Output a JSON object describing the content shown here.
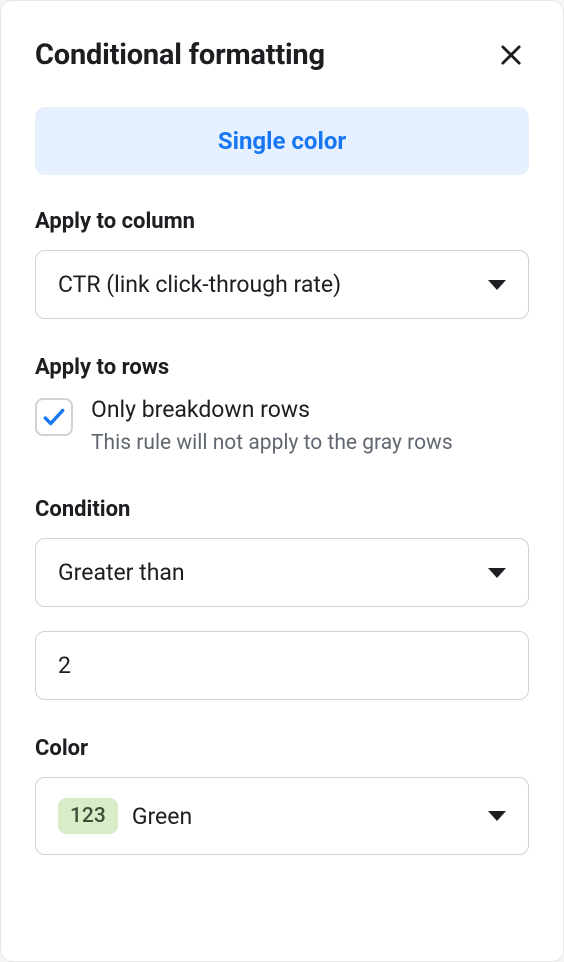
{
  "header": {
    "title": "Conditional formatting"
  },
  "tab": {
    "label": "Single color"
  },
  "applyColumn": {
    "label": "Apply to column",
    "value": "CTR (link click-through rate)"
  },
  "applyRows": {
    "label": "Apply to rows",
    "checkboxLabel": "Only breakdown rows",
    "checkboxDescription": "This rule will not apply to the gray rows",
    "checked": true
  },
  "condition": {
    "label": "Condition",
    "operator": "Greater than",
    "value": "2"
  },
  "color": {
    "label": "Color",
    "swatchText": "123",
    "name": "Green",
    "swatchBg": "#d9ecc8"
  }
}
